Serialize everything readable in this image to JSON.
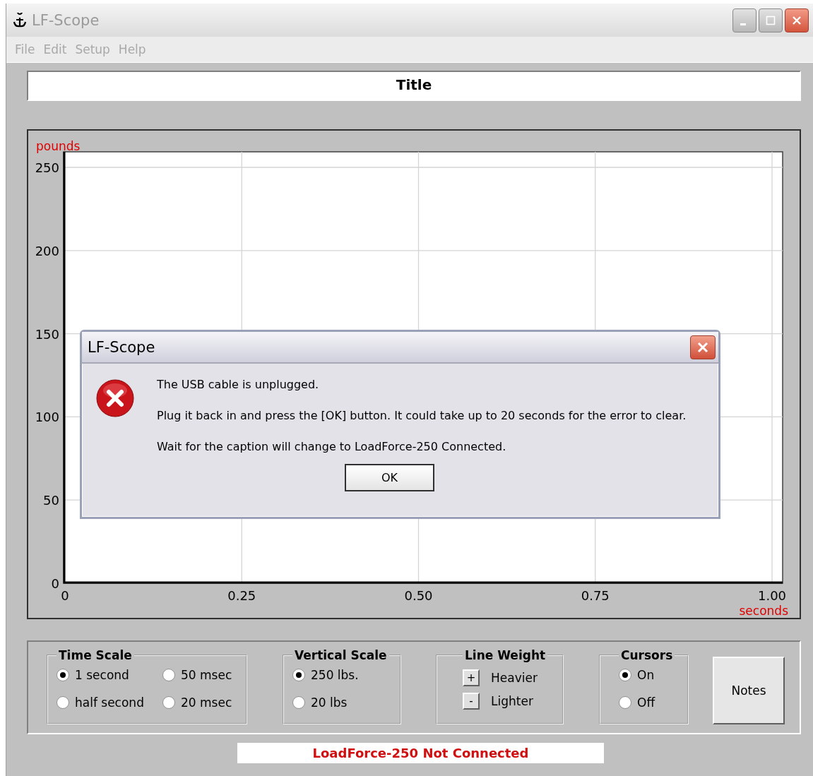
{
  "window": {
    "title": "LF-Scope",
    "active": false
  },
  "menu": [
    "File",
    "Edit",
    "Setup",
    "Help"
  ],
  "title_field": {
    "value": "Title"
  },
  "chart": {
    "chart_data": {
      "type": "line",
      "grid": true,
      "xlabel": "seconds",
      "ylabel": "pounds",
      "xlim": [
        0,
        1
      ],
      "ylim": [
        0,
        250
      ],
      "xticks": [
        {
          "value": 0,
          "label": "0"
        },
        {
          "value": 0.25,
          "label": "0.25"
        },
        {
          "value": 0.5,
          "label": "0.50"
        },
        {
          "value": 0.75,
          "label": "0.75"
        },
        {
          "value": 1,
          "label": "1.00"
        }
      ],
      "yticks": [
        0,
        50,
        100,
        150,
        200,
        250
      ]
    }
  },
  "controls": [
    {
      "kind": "radio",
      "title": "Time Scale",
      "options": [
        {
          "label": "1 second",
          "selected": true
        },
        {
          "label": "50 msec",
          "selected": false
        },
        {
          "label": "half second",
          "selected": false
        },
        {
          "label": "20 msec",
          "selected": false
        }
      ]
    },
    {
      "kind": "radio",
      "title": "Vertical Scale",
      "options": [
        {
          "label": "250 lbs.",
          "selected": true
        },
        {
          "label": "20 lbs",
          "selected": false
        }
      ]
    },
    {
      "kind": "stepper",
      "title": "Line Weight",
      "steps": [
        {
          "symbol": "+",
          "label": "Heavier"
        },
        {
          "symbol": "-",
          "label": "Lighter"
        }
      ]
    },
    {
      "kind": "radio",
      "title": "Cursors",
      "options": [
        {
          "label": "On",
          "selected": true
        },
        {
          "label": "Off",
          "selected": false
        }
      ]
    }
  ],
  "notes_button": "Notes",
  "status": {
    "text": "LoadForce-250 Not Connected"
  },
  "dialog": {
    "title": "LF-Scope",
    "messages": [
      "The USB cable is unplugged.",
      "Plug it back in and press the [OK] button.  It could take up to 20 seconds for the error to clear.",
      "Wait for the caption will change to LoadForce-250 Connected."
    ],
    "button": "OK"
  }
}
